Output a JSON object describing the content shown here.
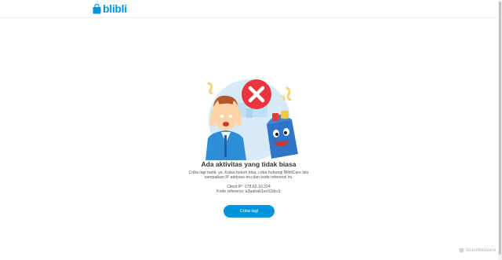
{
  "header": {
    "logo_text": "blibli"
  },
  "main": {
    "title": "Ada aktivitas yang tidak biasa",
    "message": "Coba lagi nanti, ya. Kalau belum bisa, coba hubungi BlibliCare lalu sampaikan IP address-mu dan kode referensi ini.",
    "client_ip": "Client IP: 178.63.16.224",
    "reference_code": "Kode referensi: a3aaba61ec02dcc1",
    "retry_label": "Coba lagi"
  },
  "watermark": {
    "text": "ScanMalware"
  },
  "colors": {
    "brand": "#0095da",
    "error": "#e8353f"
  }
}
